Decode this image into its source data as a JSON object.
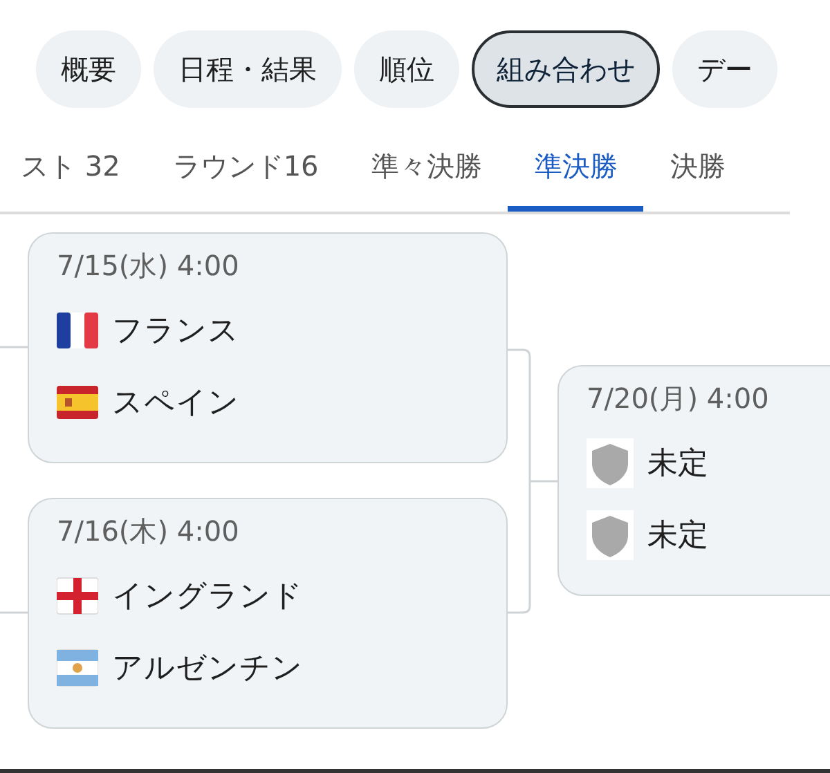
{
  "chips": [
    {
      "label": "概要",
      "selected": false
    },
    {
      "label": "日程・結果",
      "selected": false
    },
    {
      "label": "順位",
      "selected": false
    },
    {
      "label": "組み合わせ",
      "selected": true
    },
    {
      "label": "デー",
      "selected": false
    }
  ],
  "round_tabs": [
    {
      "label": "スト 32",
      "selected": false
    },
    {
      "label": "ラウンド16",
      "selected": false
    },
    {
      "label": "準々決勝",
      "selected": false
    },
    {
      "label": "準決勝",
      "selected": true
    },
    {
      "label": "決勝",
      "selected": false
    }
  ],
  "semifinals": [
    {
      "date": "7/15(水) 4:00",
      "teams": [
        {
          "name": "フランス",
          "kind": "france"
        },
        {
          "name": "スペイン",
          "kind": "spain"
        }
      ]
    },
    {
      "date": "7/16(木) 4:00",
      "teams": [
        {
          "name": "イングランド",
          "kind": "england"
        },
        {
          "name": "アルゼンチン",
          "kind": "argentina"
        }
      ]
    }
  ],
  "final": {
    "date": "7/20(月) 4:00",
    "teams": [
      {
        "name": "未定",
        "kind": "undecided"
      },
      {
        "name": "未定",
        "kind": "undecided"
      }
    ]
  }
}
